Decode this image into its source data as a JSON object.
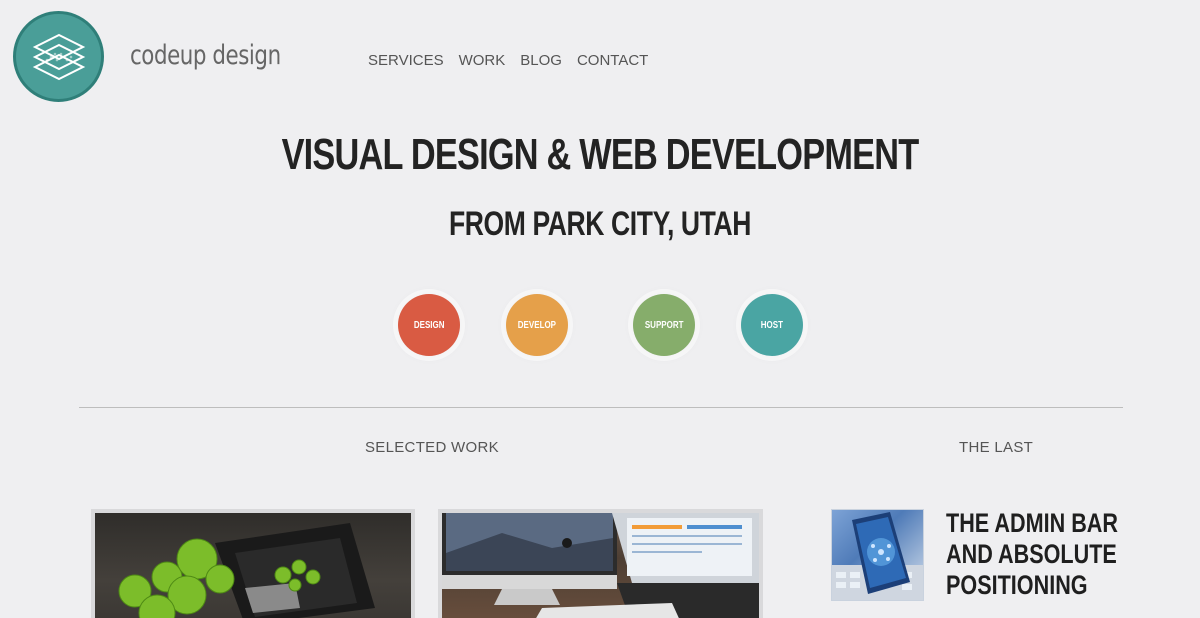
{
  "brand": {
    "name": "codeup design",
    "logo_color": "#4a9e98"
  },
  "nav": {
    "items": [
      "SERVICES",
      "WORK",
      "BLOG",
      "CONTACT"
    ]
  },
  "hero": {
    "title": "VISUAL DESIGN & WEB DEVELOPMENT",
    "subtitle": "FROM PARK CITY, UTAH"
  },
  "services": [
    {
      "label": "DESIGN",
      "color": "#d95b43"
    },
    {
      "label": "DEVELOP",
      "color": "#e5a04a"
    },
    {
      "label": "SUPPORT",
      "color": "#86ad6b"
    },
    {
      "label": "HOST",
      "color": "#4aa5a3"
    }
  ],
  "sections": {
    "work_label": "SELECTED WORK",
    "blog_label": "THE LAST"
  },
  "blog": {
    "post_title": "THE ADMIN BAR AND ABSOLUTE POSITIONING"
  }
}
